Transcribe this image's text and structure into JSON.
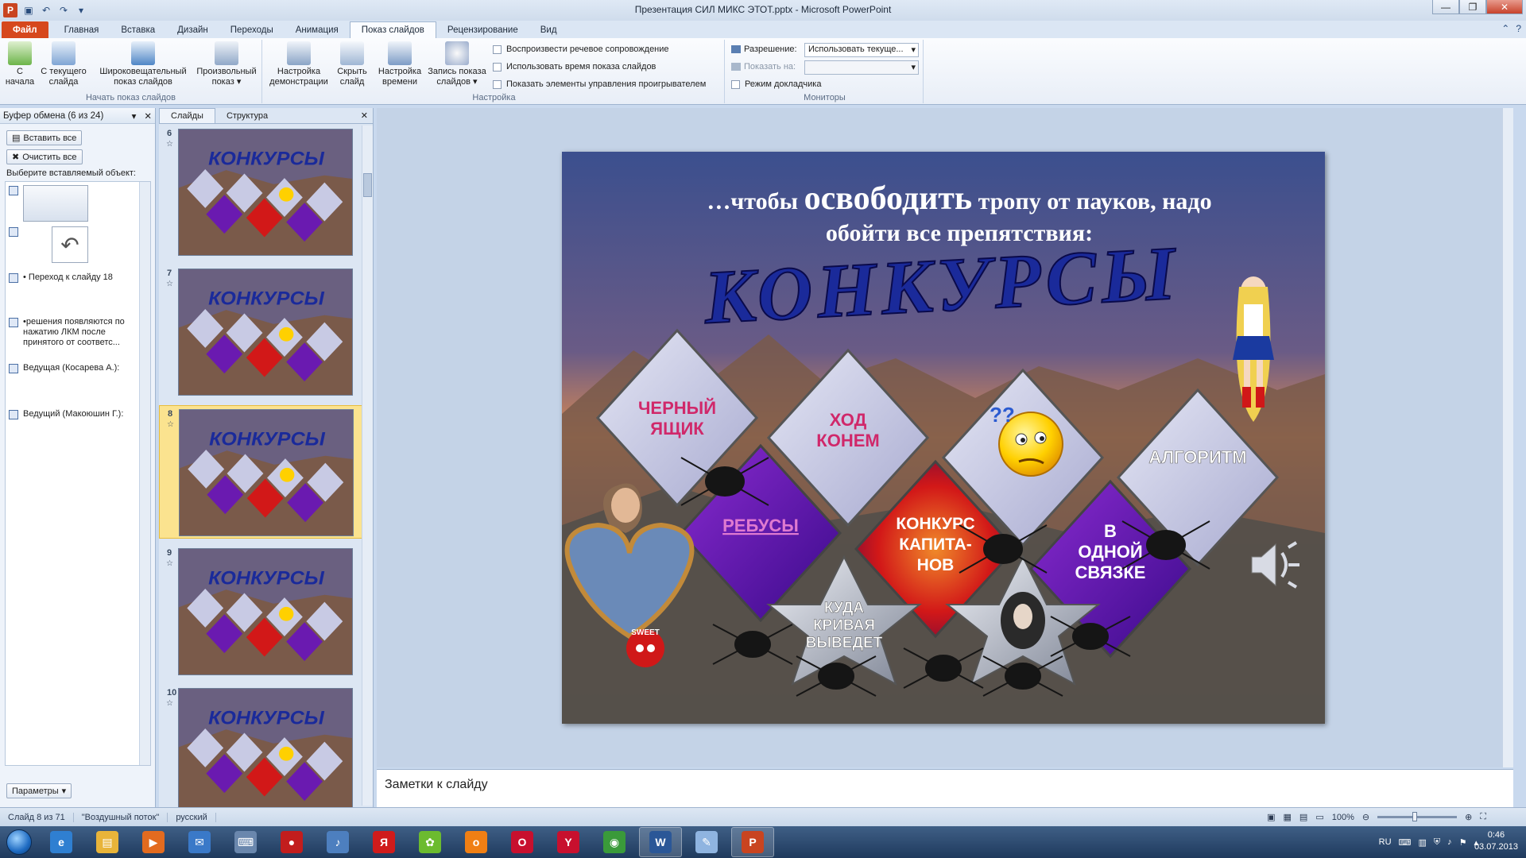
{
  "window": {
    "title": "Презентация СИЛ МИКС ЭТОТ.pptx - Microsoft PowerPoint",
    "app_icon": "P"
  },
  "tabs": [
    {
      "label": "Файл"
    },
    {
      "label": "Главная"
    },
    {
      "label": "Вставка"
    },
    {
      "label": "Дизайн"
    },
    {
      "label": "Переходы"
    },
    {
      "label": "Анимация"
    },
    {
      "label": "Показ слайдов"
    },
    {
      "label": "Рецензирование"
    },
    {
      "label": "Вид"
    }
  ],
  "ribbon": {
    "group_start": {
      "label": "Начать показ слайдов",
      "from_start": "С\nначала",
      "from_current": "С текущего\nслайда",
      "broadcast": "Широковещательный\nпоказ слайдов",
      "custom": "Произвольный\nпоказ ▾"
    },
    "group_setup": {
      "label": "Настройка",
      "setup_show": "Настройка\nдемонстрации",
      "hide_slide": "Скрыть\nслайд",
      "rehearse": "Настройка\nвремени",
      "record": "Запись показа\nслайдов ▾",
      "chk_narration": "Воспроизвести речевое сопровождение",
      "chk_timings": "Использовать время показа слайдов",
      "chk_media": "Показать элементы управления проигрывателем"
    },
    "group_monitors": {
      "label": "Мониторы",
      "resolution_label": "Разрешение:",
      "resolution_value": "Использовать текуще...",
      "show_on_label": "Показать на:",
      "show_on_value": "",
      "presenter_view": "Режим докладчика"
    }
  },
  "clipboard": {
    "title": "Буфер обмена (6 из 24)",
    "paste_all": "Вставить все",
    "clear_all": "Очистить все",
    "prompt": "Выберите вставляемый объект:",
    "items": [
      {
        "text": ""
      },
      {
        "text": ""
      },
      {
        "text": "• Переход к слайду 18"
      },
      {
        "text": "•решения появляются по нажатию ЛКМ после принятого от соответс..."
      },
      {
        "text": "Ведущая (Косарева А.):"
      },
      {
        "text": "Ведущий (Макоюшин Г.):"
      }
    ],
    "options": "Параметры"
  },
  "slides_panel": {
    "tab_slides": "Слайды",
    "tab_outline": "Структура",
    "thumbnails": [
      {
        "num": "6"
      },
      {
        "num": "7"
      },
      {
        "num": "8"
      },
      {
        "num": "9"
      },
      {
        "num": "10"
      }
    ],
    "selected_index": 2
  },
  "slide": {
    "heading_pre": "…чтобы ",
    "heading_big": "освободить",
    "heading_post": " тропу от пауков, надо",
    "heading_line2": "обойти все препятствия:",
    "title": "КОНКУРСЫ",
    "tiles": [
      {
        "text": "ЧЕРНЫЙ\nЯЩИК"
      },
      {
        "text": "ХОД\nКОНЕМ"
      },
      {
        "text": ""
      },
      {
        "text": "АЛГОРИТМ"
      },
      {
        "text": "РЕБУСЫ"
      },
      {
        "text": "КОНКУРС\nКАПИТА-\nНОВ"
      },
      {
        "text": "В\nОДНОЙ\nСВЯЗКЕ"
      }
    ],
    "star_left": "КУДА\nКРИВАЯ\nВЫВЕДЕТ",
    "emoji_text": "??",
    "sweet": "SWEET"
  },
  "notes": {
    "placeholder": "Заметки к слайду"
  },
  "status": {
    "slide_info": "Слайд 8 из 71",
    "theme": "\"Воздушный поток\"",
    "language": "русский",
    "zoom": "100%"
  },
  "taskbar": {
    "apps": [
      {
        "icon": "ie-icon",
        "color": "#2f7fd1",
        "glyph": "e"
      },
      {
        "icon": "explorer-icon",
        "color": "#e8b43a",
        "glyph": "▤"
      },
      {
        "icon": "media-player-icon",
        "color": "#e36b1f",
        "glyph": "▶"
      },
      {
        "icon": "mail-icon",
        "color": "#3a79c8",
        "glyph": "✉"
      },
      {
        "icon": "keyboard-icon",
        "color": "#6a87ad",
        "glyph": "⌨"
      },
      {
        "icon": "record-icon",
        "color": "#c21d1d",
        "glyph": "●"
      },
      {
        "icon": "sound-icon",
        "color": "#4d7fbf",
        "glyph": "♪"
      },
      {
        "icon": "yandex-icon",
        "color": "#d01b1b",
        "glyph": "Я"
      },
      {
        "icon": "icq-icon",
        "color": "#6cbb2f",
        "glyph": "✿"
      },
      {
        "icon": "odnoklassniki-icon",
        "color": "#f07f14",
        "glyph": "о"
      },
      {
        "icon": "opera-icon",
        "color": "#c8102e",
        "glyph": "O"
      },
      {
        "icon": "yandex-browser-icon",
        "color": "#c8102e",
        "glyph": "Y"
      },
      {
        "icon": "chrome-icon",
        "color": "#3a9a3a",
        "glyph": "◉"
      },
      {
        "icon": "word-icon",
        "color": "#2b5797",
        "glyph": "W"
      },
      {
        "icon": "paint-icon",
        "color": "#8fb4e0",
        "glyph": "✎"
      },
      {
        "icon": "powerpoint-icon",
        "color": "#c94420",
        "glyph": "P"
      }
    ],
    "lang": "RU",
    "time": "0:46",
    "date": "03.07.2013"
  }
}
